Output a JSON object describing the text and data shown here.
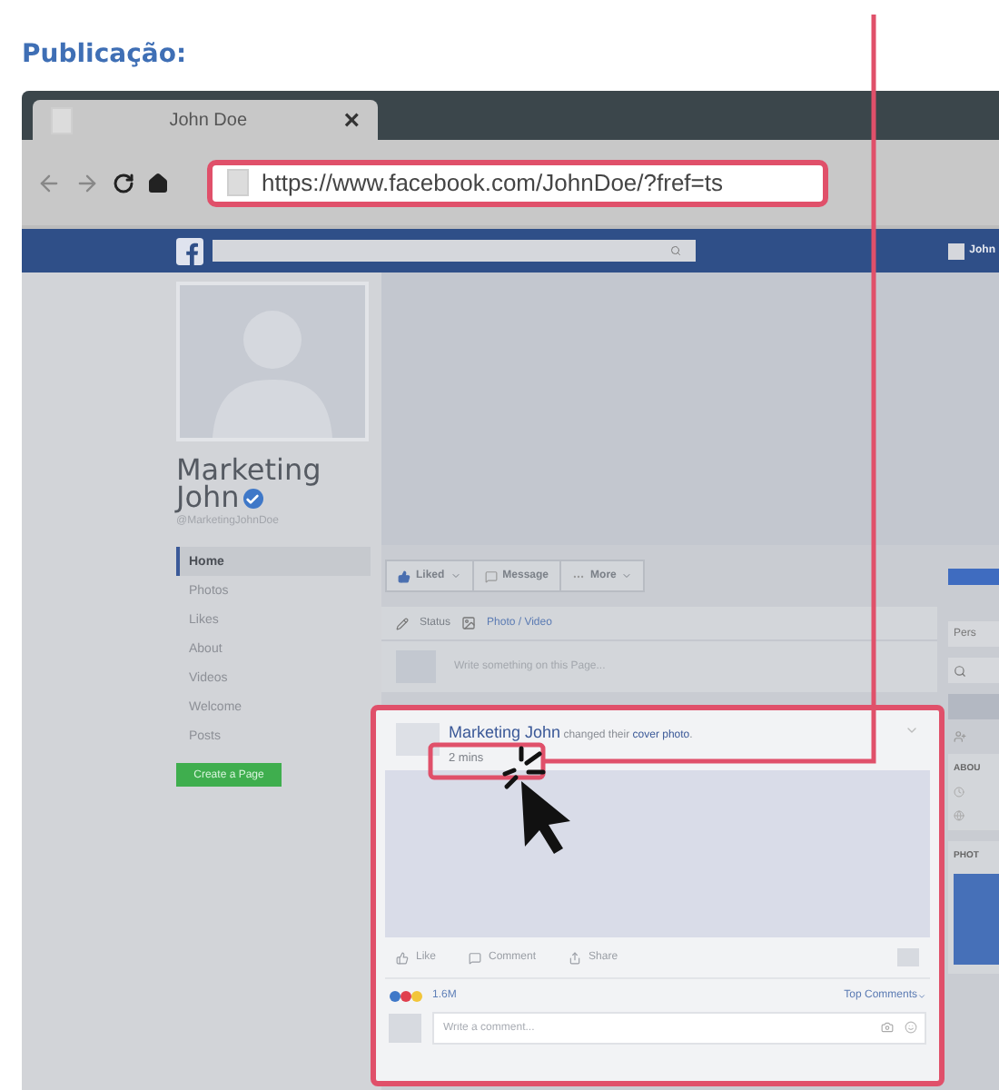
{
  "heading": "Publicação:",
  "browser": {
    "tab": {
      "title": "John Doe",
      "close": "×"
    },
    "address": {
      "url": "https://www.facebook.com/JohnDoe/?fref=ts",
      "highlighted": true
    },
    "account": "John"
  },
  "profile": {
    "name": "Marketing John",
    "handle": "@MarketingJohnDoe",
    "verified": true
  },
  "nav": [
    {
      "label": "Home",
      "selected": true
    },
    {
      "label": "Photos",
      "selected": false
    },
    {
      "label": "Likes",
      "selected": false
    },
    {
      "label": "About",
      "selected": false
    },
    {
      "label": "Videos",
      "selected": false
    },
    {
      "label": "Welcome",
      "selected": false
    },
    {
      "label": "Posts",
      "selected": false
    }
  ],
  "create_button": "Create a Page",
  "page_actions": [
    "Liked",
    "Message",
    "More"
  ],
  "composer": {
    "tabs": [
      "Status",
      "Photo / Video"
    ],
    "placeholder": "Write something on this Page..."
  },
  "post": {
    "highlighted": true,
    "author": "Marketing John",
    "action": "changed their",
    "object": "cover photo",
    "end": ".",
    "time": "2 mins",
    "actions": [
      "Like",
      "Comment",
      "Share"
    ],
    "reaction_count": "1.6M",
    "sort": "Top Comments",
    "comment_placeholder": "Write a comment..."
  },
  "right_column": {
    "box": "Pers",
    "section_1": "ABOU",
    "section_2": "PHOT"
  }
}
